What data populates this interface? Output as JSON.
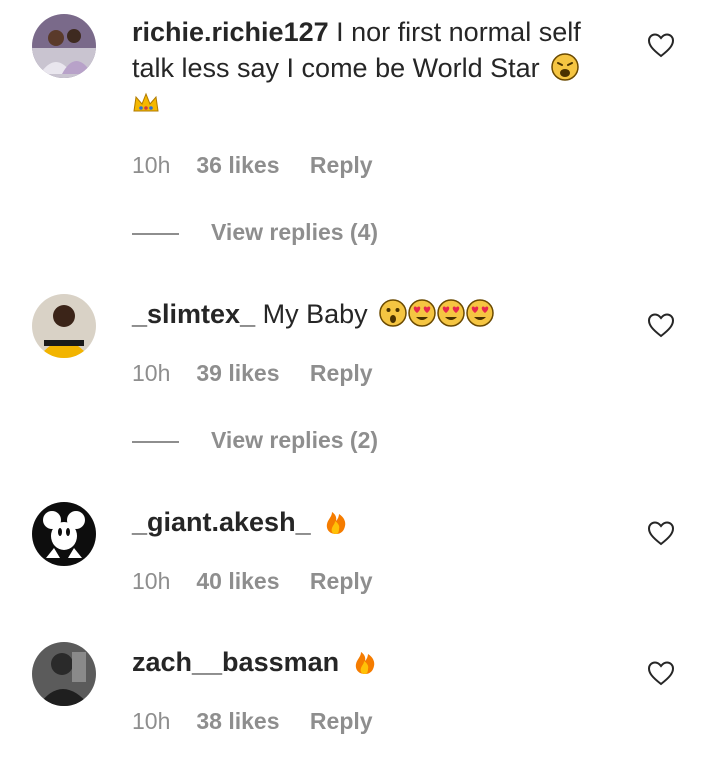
{
  "comments": [
    {
      "username": "richie.richie127",
      "text": "I nor first normal self talk less say I come be World Star",
      "emojis": [
        "weary-face-icon",
        "crown-icon"
      ],
      "time": "10h",
      "likes": "36 likes",
      "reply": "Reply",
      "view_replies": "View replies (4)"
    },
    {
      "username": "_slimtex_",
      "text": "My Baby",
      "emojis": [
        "surprised-face-icon",
        "heart-eyes-icon",
        "heart-eyes-icon",
        "heart-eyes-icon"
      ],
      "time": "10h",
      "likes": "39 likes",
      "reply": "Reply",
      "view_replies": "View replies (2)"
    },
    {
      "username": "_giant.akesh_",
      "text": "",
      "emojis": [
        "fire-icon"
      ],
      "time": "10h",
      "likes": "40 likes",
      "reply": "Reply"
    },
    {
      "username": "zach__bassman",
      "text": "",
      "emojis": [
        "fire-icon"
      ],
      "time": "10h",
      "likes": "38 likes",
      "reply": "Reply"
    }
  ],
  "colors": {
    "text": "#262626",
    "muted": "#8e8e8e",
    "background": "#ffffff"
  }
}
